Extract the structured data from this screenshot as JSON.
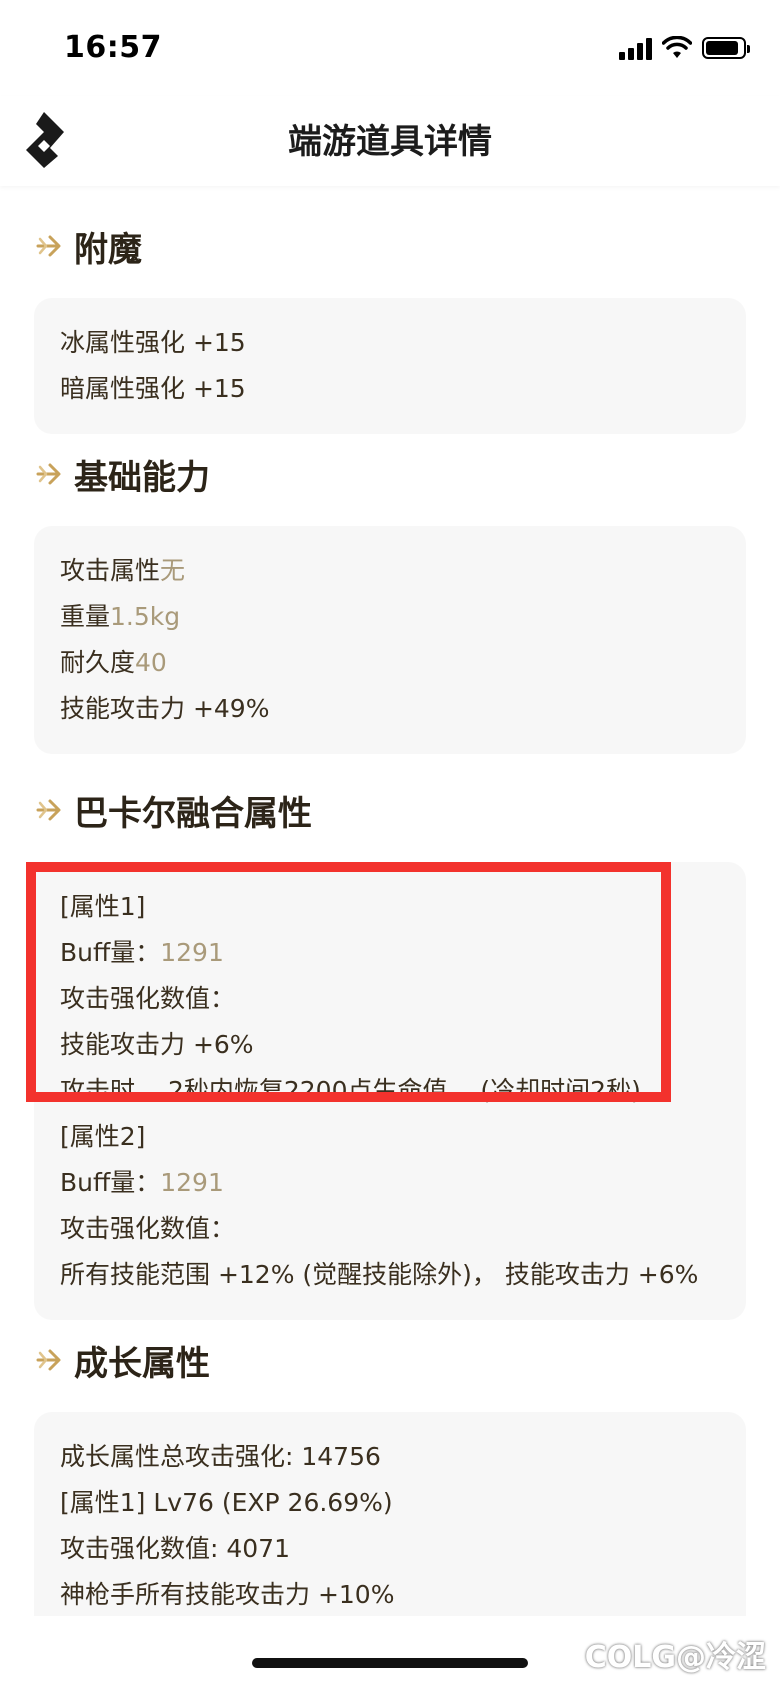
{
  "status_bar": {
    "time": "16:57"
  },
  "nav": {
    "title": "端游道具详情"
  },
  "sections": [
    {
      "title": "附魔",
      "lines": [
        {
          "label": "冰属性强化 +15",
          "value": ""
        },
        {
          "label": "暗属性强化 +15",
          "value": ""
        }
      ]
    },
    {
      "title": "基础能力",
      "lines": [
        {
          "label": "攻击属性",
          "value": "无"
        },
        {
          "label": "重量",
          "value": "1.5kg"
        },
        {
          "label": "耐久度",
          "value": "40"
        },
        {
          "label": "技能攻击力 +49%",
          "value": ""
        }
      ]
    },
    {
      "title": "巴卡尔融合属性",
      "lines": [
        {
          "label": "[属性1]",
          "value": ""
        },
        {
          "label": "Buff量：",
          "value": "1291"
        },
        {
          "label": "攻击强化数值：",
          "value": ""
        },
        {
          "label": "技能攻击力 +6%",
          "value": ""
        },
        {
          "label": "攻击时， 2秒内恢复2200点生命值。 (冷却时间2秒)",
          "value": ""
        },
        {
          "label": "[属性2]",
          "value": ""
        },
        {
          "label": "Buff量：",
          "value": "1291"
        },
        {
          "label": "攻击强化数值：",
          "value": ""
        },
        {
          "label": "所有技能范围 +12% (觉醒技能除外)， 技能攻击力 +6%",
          "value": ""
        }
      ]
    },
    {
      "title": "成长属性",
      "lines": [
        {
          "label": "成长属性总攻击强化: 14756",
          "value": ""
        },
        {
          "label": "[属性1] Lv76 (EXP 26.69%)",
          "value": ""
        },
        {
          "label": "攻击强化数值: 4071",
          "value": ""
        },
        {
          "label": "神枪手所有技能攻击力 +10%",
          "value": ""
        }
      ]
    }
  ],
  "watermark": "COLG@冷涩",
  "colors": {
    "accent": "#c8a25a",
    "value_text": "#a99a7a",
    "highlight": "#f3322d"
  }
}
